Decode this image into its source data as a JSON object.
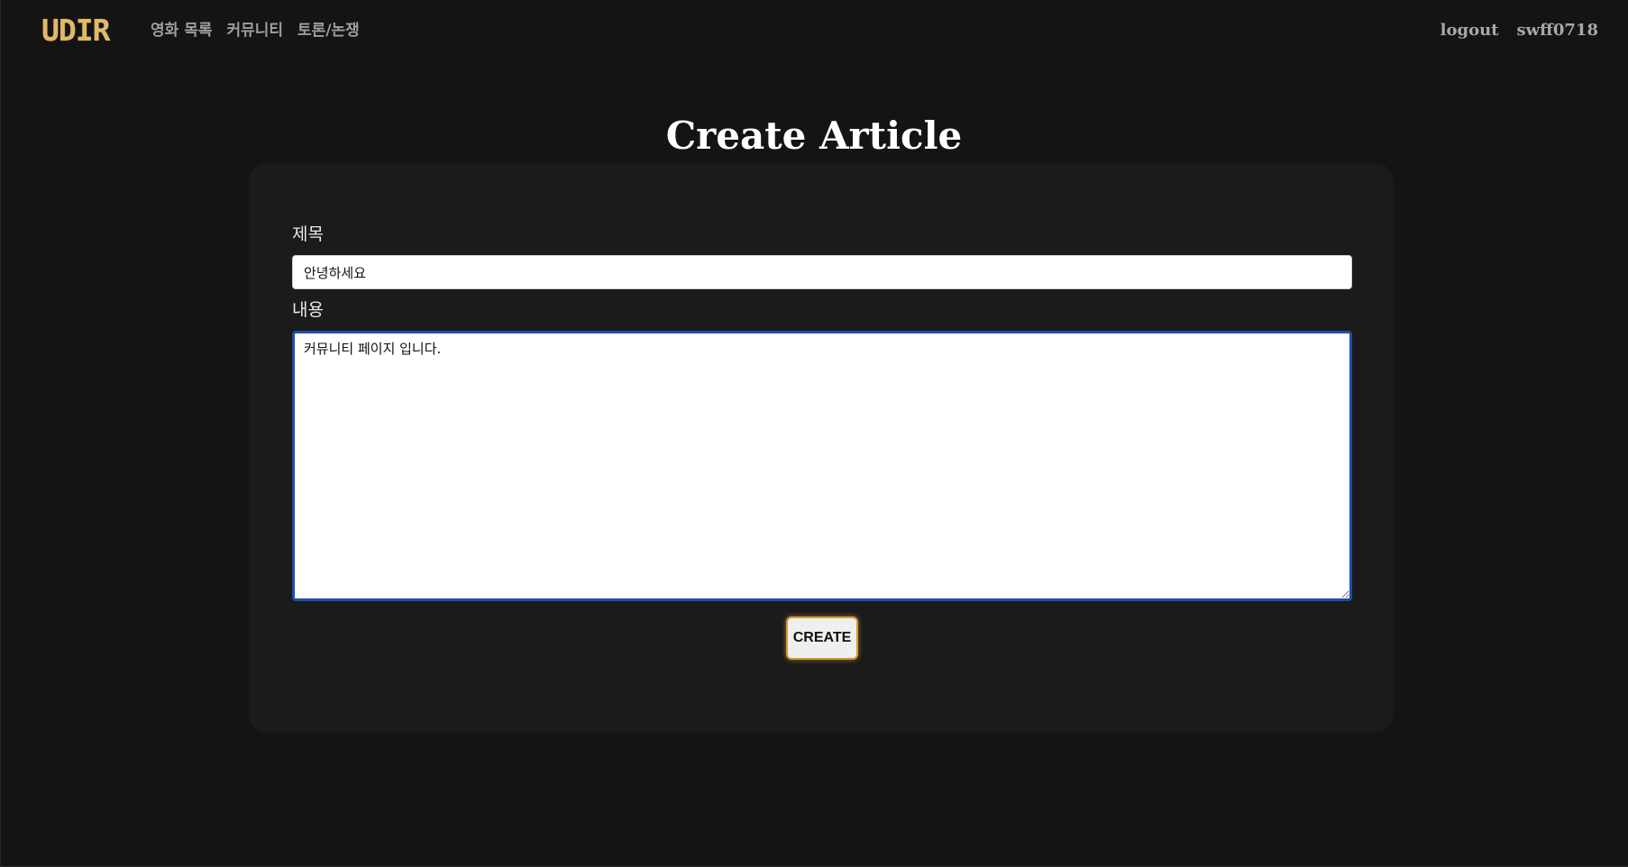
{
  "header": {
    "logo_text": "UDIR",
    "nav_links": [
      "영화 목록",
      "커뮤니티",
      "토론/논쟁"
    ],
    "logout_label": "logout",
    "username": "swff0718"
  },
  "main": {
    "title": "Create Article",
    "form": {
      "title_label": "제목",
      "title_value": "안녕하세요",
      "content_label": "내용",
      "content_value": "커뮤니티 페이지 입니다.",
      "submit_label": "CREATE"
    }
  },
  "colors": {
    "background": "#141414",
    "card": "#1b1b1b",
    "logo": "#e0b96a",
    "focus_border": "#1d4fa8",
    "button_border": "#d29a37"
  }
}
